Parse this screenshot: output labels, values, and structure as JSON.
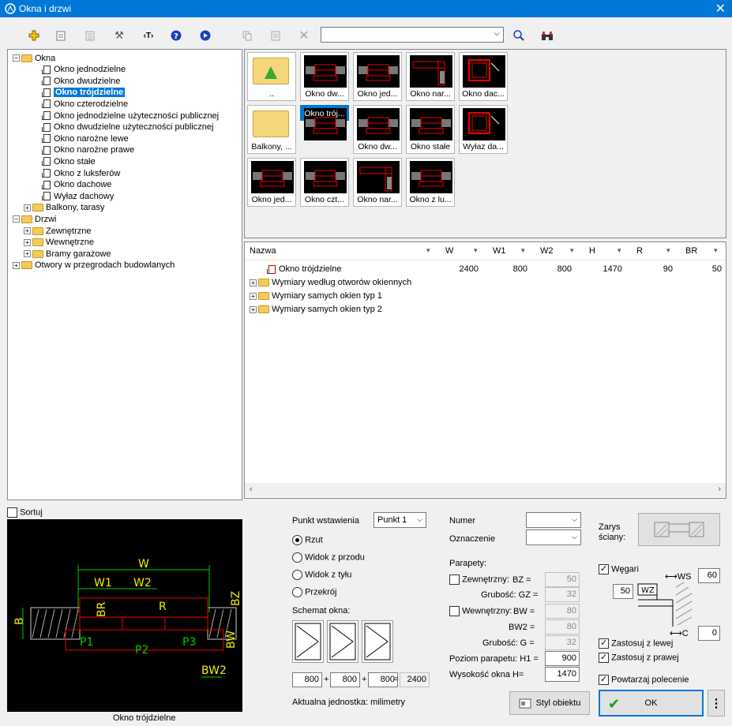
{
  "window": {
    "title": "Okna i drzwi"
  },
  "search": {
    "value": ""
  },
  "tree": [
    {
      "label": "Okna",
      "depth": 0,
      "type": "folder",
      "pm": "−"
    },
    {
      "label": "Okno jednodzielne",
      "depth": 2,
      "type": "doc"
    },
    {
      "label": "Okno dwudzielne",
      "depth": 2,
      "type": "doc"
    },
    {
      "label": "Okno trójdzielne",
      "depth": 2,
      "type": "doc",
      "selected": true
    },
    {
      "label": "Okno czterodzielne",
      "depth": 2,
      "type": "doc"
    },
    {
      "label": "Okno jednodzielne użyteczności publicznej",
      "depth": 2,
      "type": "doc"
    },
    {
      "label": "Okno dwudzielne użyteczności publicznej",
      "depth": 2,
      "type": "doc"
    },
    {
      "label": "Okno narożne lewe",
      "depth": 2,
      "type": "doc"
    },
    {
      "label": "Okno narożne prawe",
      "depth": 2,
      "type": "doc"
    },
    {
      "label": "Okno stałe",
      "depth": 2,
      "type": "doc"
    },
    {
      "label": "Okno z luksferów",
      "depth": 2,
      "type": "doc"
    },
    {
      "label": "Okno dachowe",
      "depth": 2,
      "type": "doc"
    },
    {
      "label": "Wyłaz dachowy",
      "depth": 2,
      "type": "doc"
    },
    {
      "label": "Balkony, tarasy",
      "depth": 1,
      "type": "folder",
      "pm": "+"
    },
    {
      "label": "Drzwi",
      "depth": 0,
      "type": "folder",
      "pm": "−"
    },
    {
      "label": "Zewnętrzne",
      "depth": 1,
      "type": "folder",
      "pm": "+"
    },
    {
      "label": "Wewnętrzne",
      "depth": 1,
      "type": "folder",
      "pm": "+"
    },
    {
      "label": "Bramy garażowe",
      "depth": 1,
      "type": "folder",
      "pm": "+"
    },
    {
      "label": "Otwory w przegrodach budowlanych",
      "depth": 0,
      "type": "folder",
      "pm": "+"
    }
  ],
  "thumbs": [
    {
      "label": "..",
      "kind": "up"
    },
    {
      "label": "Okno dw...",
      "kind": "win"
    },
    {
      "label": "Okno jed...",
      "kind": "win"
    },
    {
      "label": "Okno nar...",
      "kind": "corner"
    },
    {
      "label": "Okno dac...",
      "kind": "roof"
    },
    {
      "label": "Balkony, ...",
      "kind": "folder"
    },
    {
      "label": "Okno trój...",
      "kind": "win",
      "selected": true
    },
    {
      "label": "Okno dw...",
      "kind": "win"
    },
    {
      "label": "Okno stałe",
      "kind": "win"
    },
    {
      "label": "Wyłaz da...",
      "kind": "roof"
    },
    {
      "label": "Okno jed...",
      "kind": "win"
    },
    {
      "label": "Okno czt...",
      "kind": "win"
    },
    {
      "label": "Okno nar...",
      "kind": "corner"
    },
    {
      "label": "Okno z lu...",
      "kind": "win"
    }
  ],
  "grid": {
    "columns": [
      "Nazwa",
      "W",
      "W1",
      "W2",
      "H",
      "R",
      "BR"
    ],
    "rows": [
      {
        "name": "Okno trójdzielne",
        "values": [
          "2400",
          "800",
          "800",
          "1470",
          "90",
          "50"
        ],
        "icon": "doc"
      },
      {
        "name": "Wymiary według otworów okiennych",
        "values": [],
        "icon": "folder"
      },
      {
        "name": "Wymiary samych okien typ 1",
        "values": [],
        "icon": "folder"
      },
      {
        "name": "Wymiary samych okien typ 2",
        "values": [],
        "icon": "folder"
      }
    ]
  },
  "sort_label": "Sortuj",
  "preview": {
    "caption": "Okno trójdzielne",
    "labels": {
      "w": "W",
      "w1": "W1",
      "w2": "W2",
      "br": "BR",
      "r": "R",
      "bz": "BZ",
      "b": "B",
      "p1": "P1",
      "p2": "P2",
      "p3": "P3",
      "bw": "BW",
      "bw2": "BW2"
    }
  },
  "insert": {
    "label": "Punkt wstawienia",
    "value": "Punkt 1",
    "views": [
      "Rzut",
      "Widok z przodu",
      "Widok z tyłu",
      "Przekrój"
    ],
    "selected": 0
  },
  "schema": {
    "label": "Schemat okna:",
    "v1": "800",
    "v2": "800",
    "v3": "800",
    "total": "2400",
    "plus": "+",
    "eq": "="
  },
  "unit_label": "Aktualna jednostka: milimetry",
  "numer": {
    "label": "Numer",
    "value": ""
  },
  "oznaczenie": {
    "label": "Oznaczenie",
    "value": ""
  },
  "parapety": {
    "label": "Parapety:",
    "zew_label": "Zewnętrzny:",
    "bz_label": "BZ =",
    "bz": "50",
    "gz_label": "Grubość: GZ =",
    "gz": "32",
    "wew_label": "Wewnętrzny:",
    "bw_label": "BW =",
    "bw": "80",
    "bw2_label": "BW2 =",
    "bw2": "80",
    "g_label": "Grubość: G =",
    "g": "32",
    "h1_label": "Poziom parapetu: H1 =",
    "h1": "900",
    "h_label": "Wysokość okna H=",
    "h": "1470"
  },
  "zarys": {
    "label": "Zarys\nściany:"
  },
  "wegar": {
    "label": "Węgari",
    "ws_label": "WS",
    "ws": "60",
    "wz_label": "WZ",
    "wz": "50",
    "c_label": "C",
    "c": "0"
  },
  "checks": {
    "left": "Zastosuj z lewej",
    "right": "Zastosuj z prawej",
    "repeat": "Powtarzaj polecenie"
  },
  "buttons": {
    "style": "Styl obiektu",
    "ok": "OK",
    "more": "⋮"
  },
  "colors": {
    "accent": "#0078d7",
    "cad_red": "#e00000",
    "cad_green": "#00e000",
    "cad_yellow": "#e8e800"
  }
}
